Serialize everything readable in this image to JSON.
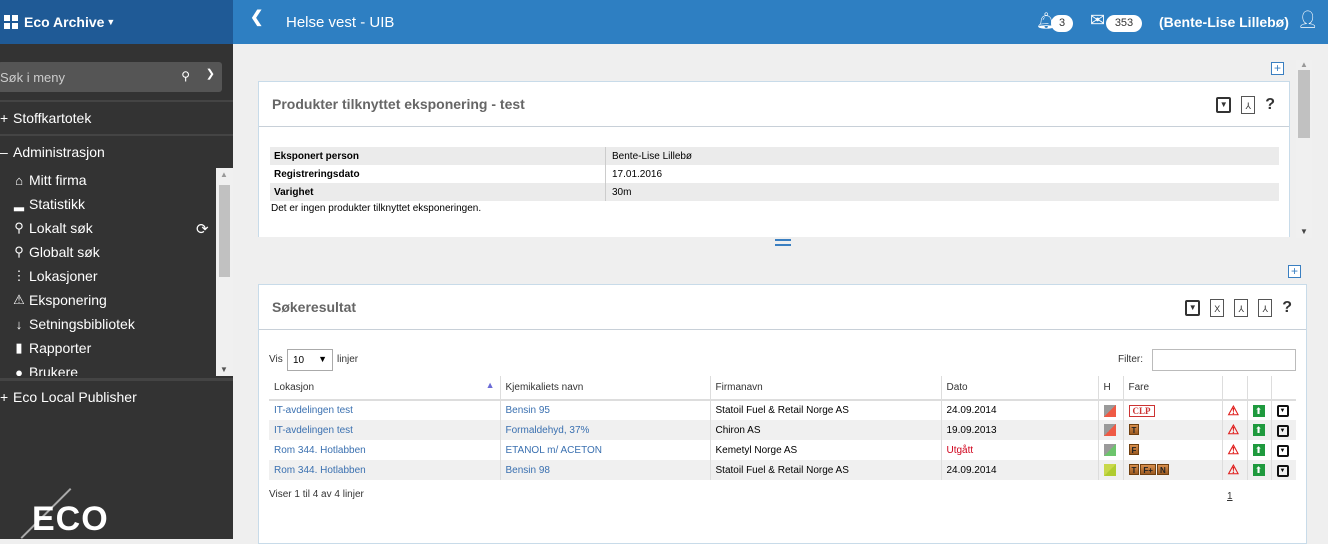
{
  "app": {
    "name": "Eco Archive"
  },
  "sidebar": {
    "search_placeholder": "Søk i meny",
    "sections": [
      {
        "sign": "+",
        "label": "Stoffkartotek"
      },
      {
        "sign": "–",
        "label": "Administrasjon"
      },
      {
        "sign": "+",
        "label": "Eco Local Publisher"
      }
    ],
    "items": [
      {
        "icon": "home-icon",
        "glyph": "⌂",
        "label": "Mitt firma"
      },
      {
        "icon": "bar-chart-icon",
        "glyph": "▂",
        "label": "Statistikk"
      },
      {
        "icon": "search-icon",
        "glyph": "⚲",
        "label": "Lokalt søk"
      },
      {
        "icon": "search-icon",
        "glyph": "⚲",
        "label": "Globalt søk"
      },
      {
        "icon": "tree-icon",
        "glyph": "⋮",
        "label": "Lokasjoner"
      },
      {
        "icon": "warning-icon",
        "glyph": "⚠",
        "label": "Eksponering"
      },
      {
        "icon": "sort-icon",
        "glyph": "↓",
        "label": "Setningsbibliotek"
      },
      {
        "icon": "report-icon",
        "glyph": "▮",
        "label": "Rapporter"
      },
      {
        "icon": "user-icon",
        "glyph": "●",
        "label": "Brukere"
      }
    ],
    "logo_text": "ECO"
  },
  "topbar": {
    "title": "Helse vest - UIB",
    "notifications": "3",
    "messages": "353",
    "user": "(Bente-Lise Lillebø)"
  },
  "panel1": {
    "title": "Produkter tilknyttet eksponering - test",
    "rows": [
      {
        "key": "Eksponert person",
        "value": "Bente-Lise Lillebø"
      },
      {
        "key": "Registreringsdato",
        "value": "17.01.2016"
      },
      {
        "key": "Varighet",
        "value": "30m"
      }
    ],
    "empty_text": "Det er ingen produkter tilknyttet eksponeringen."
  },
  "panel2": {
    "title": "Søkeresultat",
    "show_label": "Vis",
    "show_value": "10",
    "lines_label": "linjer",
    "filter_label": "Filter:",
    "filter_value": "",
    "columns": [
      "Lokasjon",
      "Kjemikaliets navn",
      "Firmanavn",
      "Dato",
      "H",
      "Fare",
      "",
      "",
      ""
    ],
    "rows": [
      {
        "lokasjon": "IT-avdelingen test",
        "navn": "Bensin 95",
        "firma": "Statoil Fuel & Retail Norge AS",
        "dato": "24.09.2014",
        "dato_expired": false,
        "h_colors": [
          "#9a9a9a",
          "#ef5a45"
        ],
        "fare": [
          "CLP"
        ],
        "fare_type": "clp"
      },
      {
        "lokasjon": "IT-avdelingen test",
        "navn": "Formaldehyd, 37%",
        "firma": "Chiron AS",
        "dato": "19.09.2013",
        "dato_expired": false,
        "h_colors": [
          "#9a9a9a",
          "#ef5a45"
        ],
        "fare": [
          "T"
        ],
        "fare_type": "symbol"
      },
      {
        "lokasjon": "Rom 344. Hotlabben",
        "navn": "ETANOL m/ ACETON",
        "firma": "Kemetyl Norge AS",
        "dato": "Utgått",
        "dato_expired": true,
        "h_colors": [
          "#9a9a9a",
          "#6cc46c"
        ],
        "fare": [
          "F"
        ],
        "fare_type": "symbol"
      },
      {
        "lokasjon": "Rom 344. Hotlabben",
        "navn": "Bensin 98",
        "firma": "Statoil Fuel & Retail Norge AS",
        "dato": "24.09.2014",
        "dato_expired": false,
        "h_colors": [
          "#c8d84a",
          "#b0cc30"
        ],
        "fare": [
          "T",
          "F+",
          "N"
        ],
        "fare_type": "symbol"
      }
    ],
    "footer": "Viser 1 til 4 av 4 linjer",
    "page": "1"
  },
  "colors": {
    "topbar": "#2e7fc2",
    "brand": "#1f5a96",
    "sidebar": "#333333",
    "link": "#3a70b0",
    "expired": "#d0021b"
  }
}
